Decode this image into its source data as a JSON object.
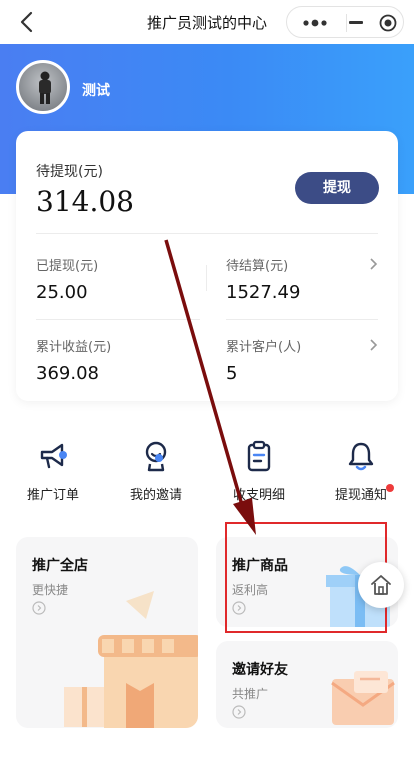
{
  "nav": {
    "title": "推广员测试的中心"
  },
  "user": {
    "name": "测试"
  },
  "balance": {
    "pending_withdraw_label": "待提现(元)",
    "pending_withdraw_value": "314.08",
    "withdraw_button": "提现",
    "withdrawn_label": "已提现(元)",
    "withdrawn_value": "25.00",
    "to_settle_label": "待结算(元)",
    "to_settle_value": "1527.49",
    "total_income_label": "累计收益(元)",
    "total_income_value": "369.08",
    "total_customers_label": "累计客户(人)",
    "total_customers_value": "5"
  },
  "actions": [
    {
      "label": "推广订单",
      "icon": "megaphone-icon"
    },
    {
      "label": "我的邀请",
      "icon": "invite-person-icon"
    },
    {
      "label": "收支明细",
      "icon": "clipboard-icon"
    },
    {
      "label": "提现通知",
      "icon": "bell-icon",
      "badge": true
    }
  ],
  "tiles": [
    {
      "title": "推广全店",
      "subtitle": "更快捷"
    },
    {
      "title": "推广商品",
      "subtitle": "返利高"
    },
    {
      "title": "邀请好友",
      "subtitle": "共推广"
    }
  ],
  "colors": {
    "header_blue": "#3b8af5",
    "button_navy": "#3c4c86",
    "annotation_red": "#e0292b",
    "annotation_arrow": "#7a0d0d",
    "badge_red": "#ee3b3b"
  }
}
